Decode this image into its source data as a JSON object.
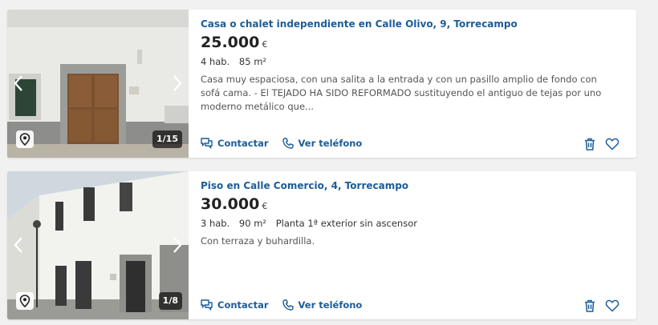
{
  "listings": [
    {
      "title": "Casa o chalet independiente en Calle Olivo, 9, Torrecampo",
      "price": "25.000",
      "currency": "€",
      "features": [
        "4 hab.",
        "85 m²"
      ],
      "description": "Casa muy espaciosa, con una salita a la entrada y con un pasillo amplio de fondo con sofá cama. - El TEJADO HA SIDO REFORMADO sustituyendo el antiguo de tejas por uno moderno metálico que...",
      "photo_counter": "1/15",
      "contact_label": "Contactar",
      "phone_label": "Ver teléfono"
    },
    {
      "title": "Piso en Calle Comercio, 4, Torrecampo",
      "price": "30.000",
      "currency": "€",
      "features": [
        "3 hab.",
        "90 m²",
        "Planta 1ª exterior sin ascensor"
      ],
      "description": "Con terraza y buhardilla.",
      "photo_counter": "1/8",
      "contact_label": "Contactar",
      "phone_label": "Ver teléfono"
    }
  ],
  "colors": {
    "link": "#1b5d99",
    "price": "#222222",
    "background": "#f1f1f1"
  }
}
